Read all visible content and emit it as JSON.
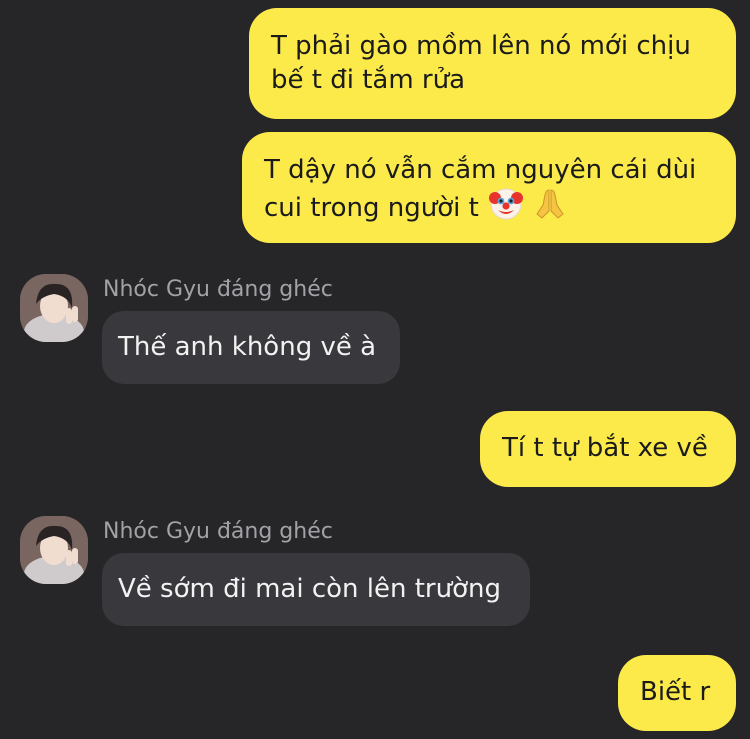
{
  "theme": {
    "background": "#262528",
    "outgoing_bubble": "#fcea4a",
    "incoming_bubble": "#39383c"
  },
  "messages": [
    {
      "direction": "outgoing",
      "text": "T phải gào mồm lên nó mới chịu bế t đi tắm rửa"
    },
    {
      "direction": "outgoing",
      "text": "T dậy nó vẫn cắm nguyên cái dùi cui trong người t",
      "emojis": [
        "clown-face-emoji",
        "folded-hands-emoji"
      ]
    },
    {
      "direction": "incoming",
      "sender": "Nhóc Gyu đáng ghéc",
      "text": "Thế anh không về à"
    },
    {
      "direction": "outgoing",
      "text": "Tí t tự bắt xe về"
    },
    {
      "direction": "incoming",
      "sender": "Nhóc Gyu đáng ghéc",
      "text": "Về sớm đi mai còn lên trường"
    },
    {
      "direction": "outgoing",
      "text": "Biết r"
    }
  ]
}
